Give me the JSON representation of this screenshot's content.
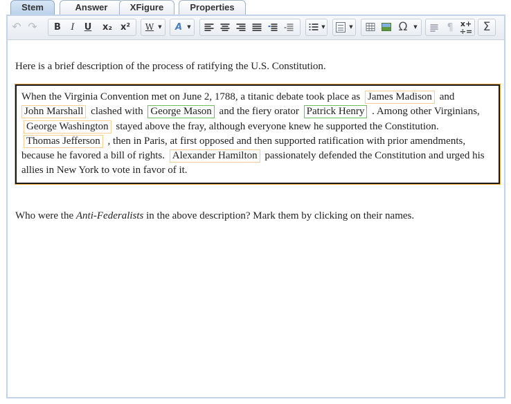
{
  "tabs": [
    {
      "label": "Stem",
      "active": true
    },
    {
      "label": "Answer",
      "active": false
    },
    {
      "label": "XFigure",
      "active": false
    },
    {
      "label": "Properties",
      "active": false
    }
  ],
  "toolbar": {
    "undo": "↶",
    "redo": "↷",
    "bold": "B",
    "italic": "I",
    "underline": "U",
    "subscript": "x₂",
    "superscript": "x²",
    "font_style": "W",
    "text_style": "A",
    "omega": "Ω",
    "pilcrow": "¶",
    "sigma": "Σ"
  },
  "content": {
    "intro": "Here is a brief description of the process of ratifying the U.S. Constitution.",
    "passage": {
      "t0": "When the Virginia Convention met on June 2, 1788, a titanic debate took place as",
      "n1": "James Madison",
      "t1": "and",
      "n2": "John Marshall",
      "t2": "clashed with",
      "n3": "George Mason",
      "t3": "and the fiery orator",
      "n4": "Patrick Henry",
      "t4": ". Among other Virginians,",
      "n5": "George Washington",
      "t5": "stayed above the fray, although everyone knew he supported the Constitution.",
      "n6": "Thomas Jefferson",
      "t6": ", then in Paris, at first opposed and then supported ratification with prior amendments, because he favored a bill of rights.",
      "n7": "Alexander Hamilton",
      "t7": "passionately defended the Constitution and urged his allies in New York to vote in favor of it."
    },
    "question_pre": "Who were the",
    "question_em": "Anti-Federalists",
    "question_post": "in the above description? Mark them by clicking on their names."
  },
  "selected_names": [
    "George Mason",
    "Patrick Henry"
  ],
  "colors": {
    "name_border": "#f6cf92",
    "selected_border": "#6cbf58",
    "passage_outline": "#f0a640",
    "tab_active": "#c6d9ef"
  }
}
